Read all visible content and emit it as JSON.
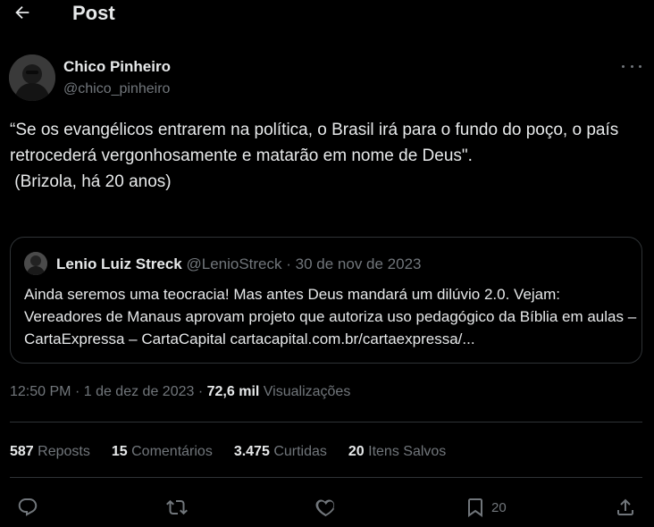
{
  "header": {
    "title": "Post",
    "back_icon": "arrow-left-icon"
  },
  "author": {
    "name": "Chico Pinheiro",
    "handle": "@chico_pinheiro"
  },
  "tweet": {
    "text": "“Se os evangélicos entrarem na política, o Brasil irá para o fundo do poço, o país retrocederá vergonhosamente e matarão em nome de Deus\".\n (Brizola, há 20 anos)"
  },
  "quote": {
    "name": "Lenio Luiz Streck",
    "handle": "@LenioStreck",
    "separator": "·",
    "date": "30 de nov de 2023",
    "text": "Ainda seremos uma teocracia! Mas antes Deus mandará um dilúvio 2.0. Vejam: Vereadores de Manaus aprovam projeto que autoriza uso pedagógico da Bíblia em aulas – CartaExpressa – CartaCapital cartacapital.com.br/cartaexpressa/..."
  },
  "meta": {
    "time": "12:50 PM",
    "separator": "·",
    "date": "1 de dez de 2023",
    "views_count": "72,6 mil",
    "views_label": "Visualizações"
  },
  "stats": {
    "reposts_count": "587",
    "reposts_label": "Reposts",
    "comments_count": "15",
    "comments_label": "Comentários",
    "likes_count": "3.475",
    "likes_label": "Curtidas",
    "saved_count": "20",
    "saved_label": "Itens Salvos"
  },
  "actions": {
    "reply_icon": "reply-icon",
    "repost_icon": "repost-icon",
    "like_icon": "heart-icon",
    "bookmark_icon": "bookmark-icon",
    "bookmark_count": "20",
    "share_icon": "share-icon"
  },
  "colors": {
    "background": "#000000",
    "text_primary": "#e7e9ea",
    "text_secondary": "#71767b",
    "border": "#2f3336"
  }
}
